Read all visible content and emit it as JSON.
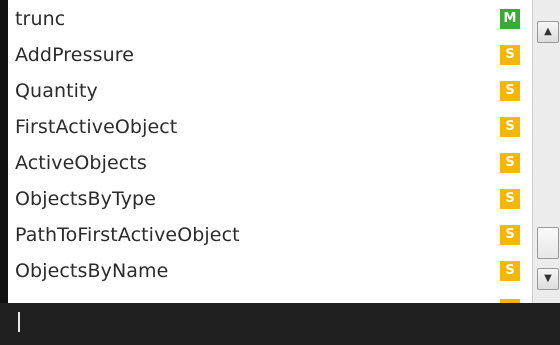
{
  "autocomplete": {
    "items": [
      {
        "label": "trunc",
        "badge": "M",
        "badge_color": "#3aaa35"
      },
      {
        "label": "AddPressure",
        "badge": "S",
        "badge_color": "#f4b800"
      },
      {
        "label": "Quantity",
        "badge": "S",
        "badge_color": "#f4b800"
      },
      {
        "label": "FirstActiveObject",
        "badge": "S",
        "badge_color": "#f4b800"
      },
      {
        "label": "ActiveObjects",
        "badge": "S",
        "badge_color": "#f4b800"
      },
      {
        "label": "ObjectsByType",
        "badge": "S",
        "badge_color": "#f4b800"
      },
      {
        "label": "PathToFirstActiveObject",
        "badge": "S",
        "badge_color": "#f4b800"
      },
      {
        "label": "ObjectsByName",
        "badge": "S",
        "badge_color": "#f4b800"
      }
    ]
  },
  "scrollbar": {
    "up_icon": "arrow-up-icon",
    "down_icon": "arrow-down-icon"
  },
  "colors": {
    "editor_background": "#202020",
    "method_badge": "#3aaa35",
    "static_badge": "#f4b800"
  }
}
